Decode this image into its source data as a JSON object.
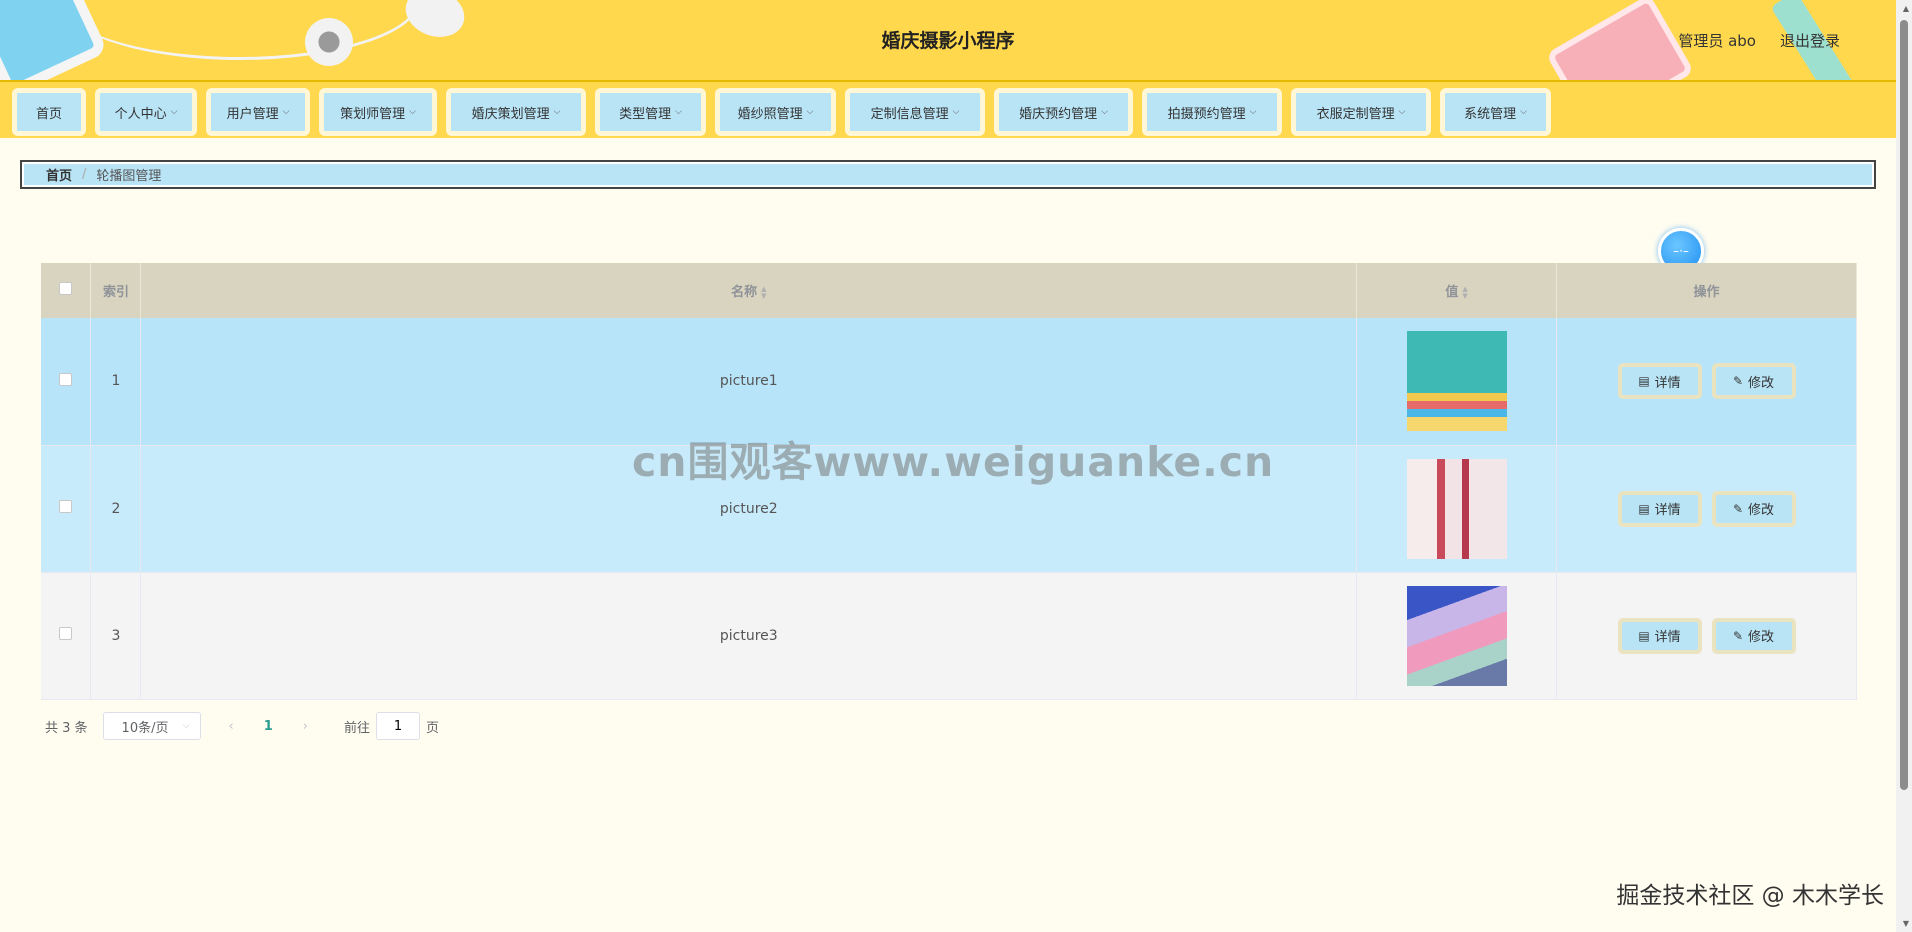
{
  "header": {
    "title": "婚庆摄影小程序",
    "role_user": "管理员 abo",
    "logout": "退出登录"
  },
  "nav": [
    {
      "label": "首页",
      "has_dropdown": false
    },
    {
      "label": "个人中心",
      "has_dropdown": true
    },
    {
      "label": "用户管理",
      "has_dropdown": true
    },
    {
      "label": "策划师管理",
      "has_dropdown": true
    },
    {
      "label": "婚庆策划管理",
      "has_dropdown": true
    },
    {
      "label": "类型管理",
      "has_dropdown": true
    },
    {
      "label": "婚纱照管理",
      "has_dropdown": true
    },
    {
      "label": "定制信息管理",
      "has_dropdown": true
    },
    {
      "label": "婚庆预约管理",
      "has_dropdown": true
    },
    {
      "label": "拍摄预约管理",
      "has_dropdown": true
    },
    {
      "label": "衣服定制管理",
      "has_dropdown": true
    },
    {
      "label": "系统管理",
      "has_dropdown": true
    }
  ],
  "breadcrumb": {
    "home": "首页",
    "separator": "/",
    "current": "轮播图管理"
  },
  "table": {
    "columns": {
      "index": "索引",
      "name": "名称",
      "value": "值",
      "actions": "操作"
    },
    "rows": [
      {
        "index": "1",
        "name": "picture1"
      },
      {
        "index": "2",
        "name": "picture2"
      },
      {
        "index": "3",
        "name": "picture3"
      }
    ],
    "detail_label": "详情",
    "edit_label": "修改"
  },
  "pagination": {
    "total": "共 3 条",
    "page_size": "10条/页",
    "current_page": "1",
    "goto_prefix": "前往",
    "goto_value": "1",
    "goto_suffix": "页"
  },
  "watermarks": {
    "center": "cn围观客www.weiguanke.cn",
    "corner": "掘金技术社区 @ 木木学长"
  },
  "colors": {
    "header_bg": "#ffd84d",
    "button_bg": "#b9e4f6",
    "table_header_bg": "#d8d4bf",
    "page_bg": "#fffdf0"
  }
}
